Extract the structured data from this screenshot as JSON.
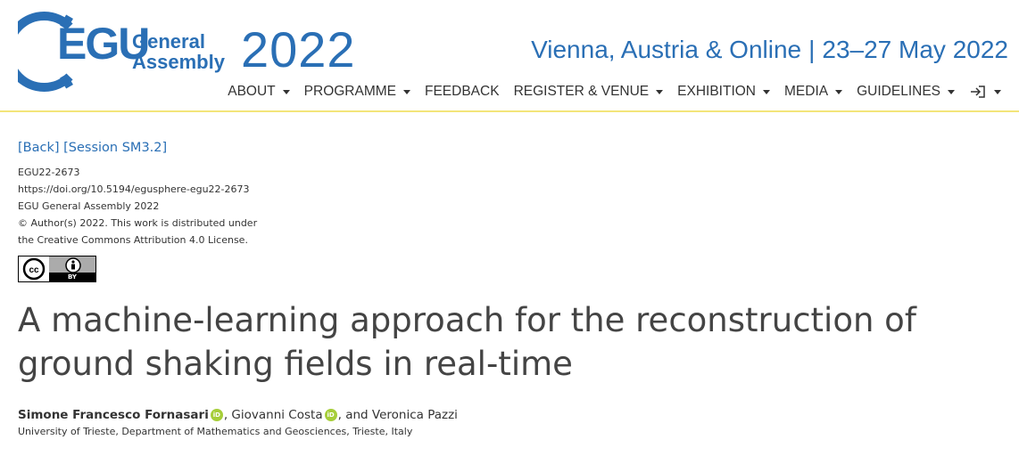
{
  "header": {
    "logo": {
      "egu": "EGU",
      "general": "General",
      "assembly": "Assembly",
      "year": "2022"
    },
    "location": "Vienna, Austria & Online",
    "separator": "|",
    "dates": "23–27 May 2022",
    "nav": [
      {
        "label": "ABOUT",
        "dropdown": true
      },
      {
        "label": "PROGRAMME",
        "dropdown": true
      },
      {
        "label": "FEEDBACK",
        "dropdown": false
      },
      {
        "label": "REGISTER & VENUE",
        "dropdown": true
      },
      {
        "label": "EXHIBITION",
        "dropdown": true
      },
      {
        "label": "MEDIA",
        "dropdown": true
      },
      {
        "label": "GUIDELINES",
        "dropdown": true
      }
    ],
    "login_icon": "login-icon"
  },
  "links": {
    "back": "[Back]",
    "session": "[Session SM3.2]"
  },
  "meta": {
    "id": "EGU22-2673",
    "doi": "https://doi.org/10.5194/egusphere-egu22-2673",
    "conference": "EGU General Assembly 2022",
    "copyright_1": "© Author(s) 2022. This work is distributed under",
    "copyright_2": "the Creative Commons Attribution 4.0 License."
  },
  "license_badge": {
    "by": "BY"
  },
  "abstract": {
    "title": "A machine-learning approach for the reconstruction of ground shaking fields in real-time",
    "authors": [
      {
        "name": "Simone Francesco Fornasari",
        "bold": true,
        "orcid": true,
        "sep": ""
      },
      {
        "name": "Giovanni Costa",
        "bold": false,
        "orcid": true,
        "sep": ", "
      },
      {
        "name": "Veronica Pazzi",
        "bold": false,
        "orcid": false,
        "sep": ", and "
      }
    ],
    "orcid_label": "iD",
    "affiliation": "University of Trieste, Department of Mathematics and Geosciences, Trieste, Italy"
  },
  "colors": {
    "brand": "#2a6fb5",
    "accent_line": "#f3e57a",
    "orcid": "#a6ce39"
  }
}
